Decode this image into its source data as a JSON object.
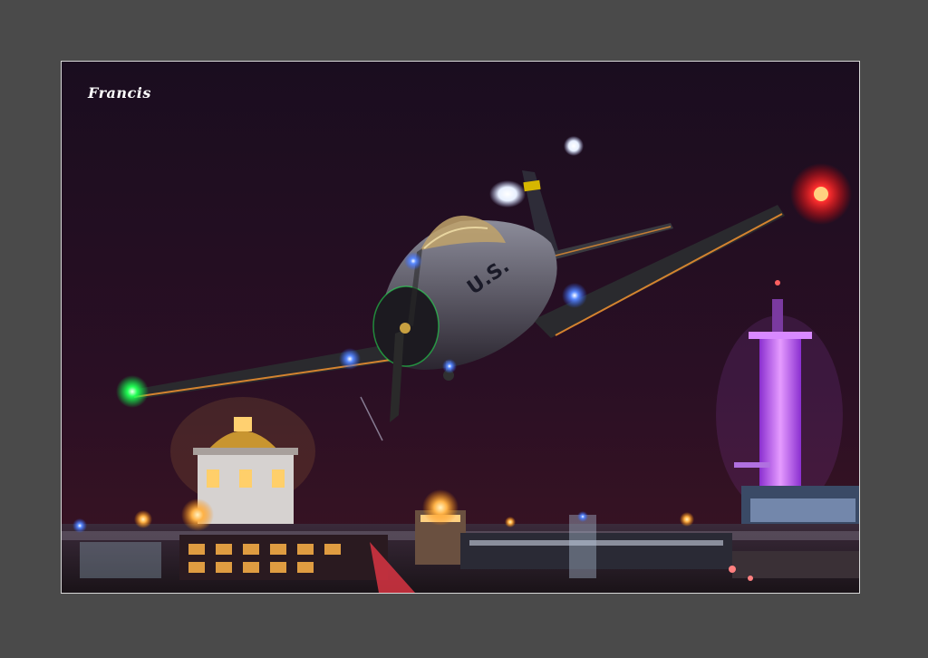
{
  "photo": {
    "signature": "Francis",
    "fuselage_marking": "U.S.",
    "colors": {
      "matte": "#4a4a4a",
      "sky_top": "#1b0f1e",
      "sky_bottom": "#3a1222",
      "nav_light_port": "#ff2a2a",
      "nav_light_starboard": "#22ff55",
      "strobe": "#4a7bff",
      "tower_glow": "#c85cff",
      "city_glow": "#ffb347"
    }
  }
}
